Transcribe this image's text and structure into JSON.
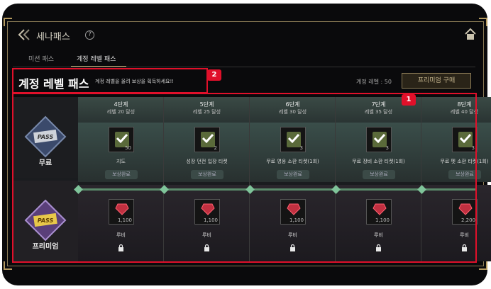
{
  "window": {
    "title": "세나패스",
    "help_glyph": "?"
  },
  "tabs": [
    {
      "label": "미션 패스",
      "active": false
    },
    {
      "label": "계정 레벨 패스",
      "active": true
    }
  ],
  "header": {
    "title": "계정 레벨 패스",
    "description": "계정 레벨을 올려 보상을 획득하세요!!",
    "level_label": "계정 레벨 : 50",
    "premium_button": "프리미엄 구매"
  },
  "callouts": [
    {
      "number": "1"
    },
    {
      "number": "2"
    }
  ],
  "rows": {
    "free_label": "무료",
    "premium_label": "프리미엄",
    "free_pass_word": "PASS",
    "premium_pass_word": "PASS"
  },
  "stages": [
    {
      "stage": "4단계",
      "cond": "레벨 20 달성",
      "free_item": "지도",
      "free_qty": "50",
      "claimed": "보상완료",
      "prem_item": "루비",
      "prem_qty": "1,100"
    },
    {
      "stage": "5단계",
      "cond": "레벨 25 달성",
      "free_item": "성장 던전 입장 티켓",
      "free_qty": "2",
      "claimed": "보상완료",
      "prem_item": "루비",
      "prem_qty": "1,100"
    },
    {
      "stage": "6단계",
      "cond": "레벨 30 달성",
      "free_item": "무료 영웅 소환 티켓(1회)",
      "free_qty": "3",
      "claimed": "보상완료",
      "prem_item": "루비",
      "prem_qty": "1,100"
    },
    {
      "stage": "7단계",
      "cond": "레벨 35 달성",
      "free_item": "무료 장비 소환 티켓(1회)",
      "free_qty": "3",
      "claimed": "보상완료",
      "prem_item": "루비",
      "prem_qty": "1,100"
    },
    {
      "stage": "8단계",
      "cond": "레벨 40 달성",
      "free_item": "무료 펫 소환 티켓(1회)",
      "free_qty": "3",
      "claimed": "보상완료",
      "prem_item": "루비",
      "prem_qty": "2,200"
    }
  ],
  "colors": {
    "callout": "#e0102a",
    "track": "#7fc49a",
    "gold": "#c9b27a"
  }
}
